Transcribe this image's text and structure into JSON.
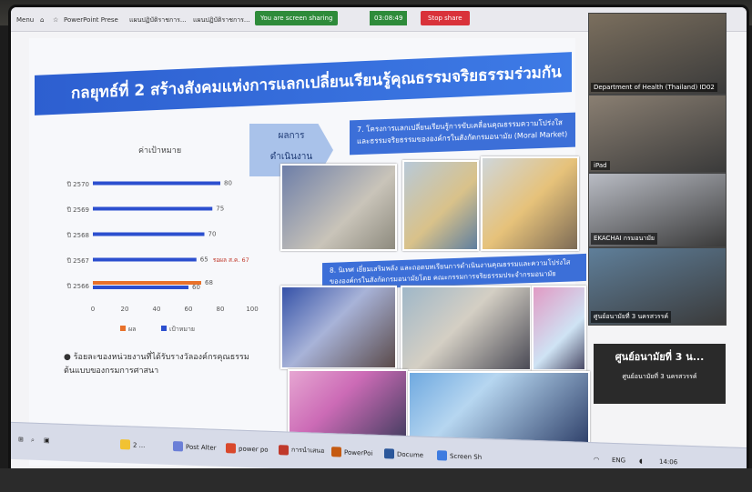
{
  "browser": {
    "menu_label": "Menu",
    "tabs": [
      "PowerPoint Presentation",
      "แผนปฏิบัติราชการ...",
      "แผนปฏิบัติราชการ..."
    ],
    "share_text": "You are screen sharing",
    "timer": "03:08:49",
    "stop_share": "Stop share"
  },
  "slide": {
    "title": "กลยุทธ์ที่ 2 สร้างสังคมแห่งการแลกเปลี่ยนเรียนรู้คุณธรรมจริยธรรมร่วมกัน",
    "chart_heading": "ค่าเป้าหมาย",
    "result_label_1": "ผลการ",
    "result_label_2": "ดำเนินงาน",
    "project1": "7. โครงการแลกเปลี่ยนเรียนรู้การขับเคลื่อนคุณธรรมความโปร่งใสและธรรมจริยธรรมขององค์กรในสังกัดกรมอนามัย (Moral Market)",
    "project2": "8. นิเทศ เยี่ยมเสริมพลัง และถอดบทเรียนการดำเนินงานคุณธรรมและความโปร่งใสขององค์กรในสังกัดกรมอนามัยโดย คณะกรรมการจริยธรรมประจำกรมอนามัย",
    "bullet_note": "● ร้อยละของหน่วยงานที่ได้รับรางวัลองค์กรคุณธรรมต้นแบบของกรมการศาสนา",
    "annotation": "รอผล ส.ค. 67"
  },
  "chart_data": {
    "type": "bar",
    "orientation": "horizontal",
    "categories": [
      "ปี 2566",
      "ปี 2567",
      "ปี 2568",
      "ปี 2569",
      "ปี 2570"
    ],
    "series": [
      {
        "name": "ผล",
        "color": "#e8712a",
        "values": [
          68,
          null,
          null,
          null,
          null
        ]
      },
      {
        "name": "เป้าหมาย",
        "color": "#2c4fcf",
        "values": [
          60,
          65,
          70,
          75,
          80
        ]
      }
    ],
    "xlim": [
      0,
      100
    ],
    "xticks": [
      0,
      20,
      40,
      60,
      80,
      100
    ],
    "legend_position": "bottom"
  },
  "video": {
    "tiles": [
      {
        "name": "Department of Health (Thailand) ID02",
        "bg": "#7b6f5e"
      },
      {
        "name": "iPad",
        "bg": "#8a7f72"
      },
      {
        "name": "EKACHAI กรมอนามัย",
        "bg": "#b9bcc4"
      },
      {
        "name": "ศูนย์อนามัยที่ 3 นครสวรรค์",
        "bg": "#5f7f9a"
      }
    ],
    "center_label": "ศูนย์อนามัยที่ 3 น...",
    "center_sub": "ศูนย์อนามัยที่ 3 นครสวรรค์"
  },
  "taskbar": {
    "items": [
      {
        "label": "2 ...",
        "color": "#f1c232"
      },
      {
        "label": "Post Alter",
        "color": "#6b7fd7"
      },
      {
        "label": "power po",
        "color": "#d9482b"
      },
      {
        "label": "การนำเสนอ",
        "color": "#c0392b"
      },
      {
        "label": "PowerPoi",
        "color": "#c55a11"
      },
      {
        "label": "Docume",
        "color": "#2b579a"
      },
      {
        "label": "Screen Sh",
        "color": "#3d7be0"
      }
    ],
    "lang": "ENG",
    "time": "14:06"
  }
}
